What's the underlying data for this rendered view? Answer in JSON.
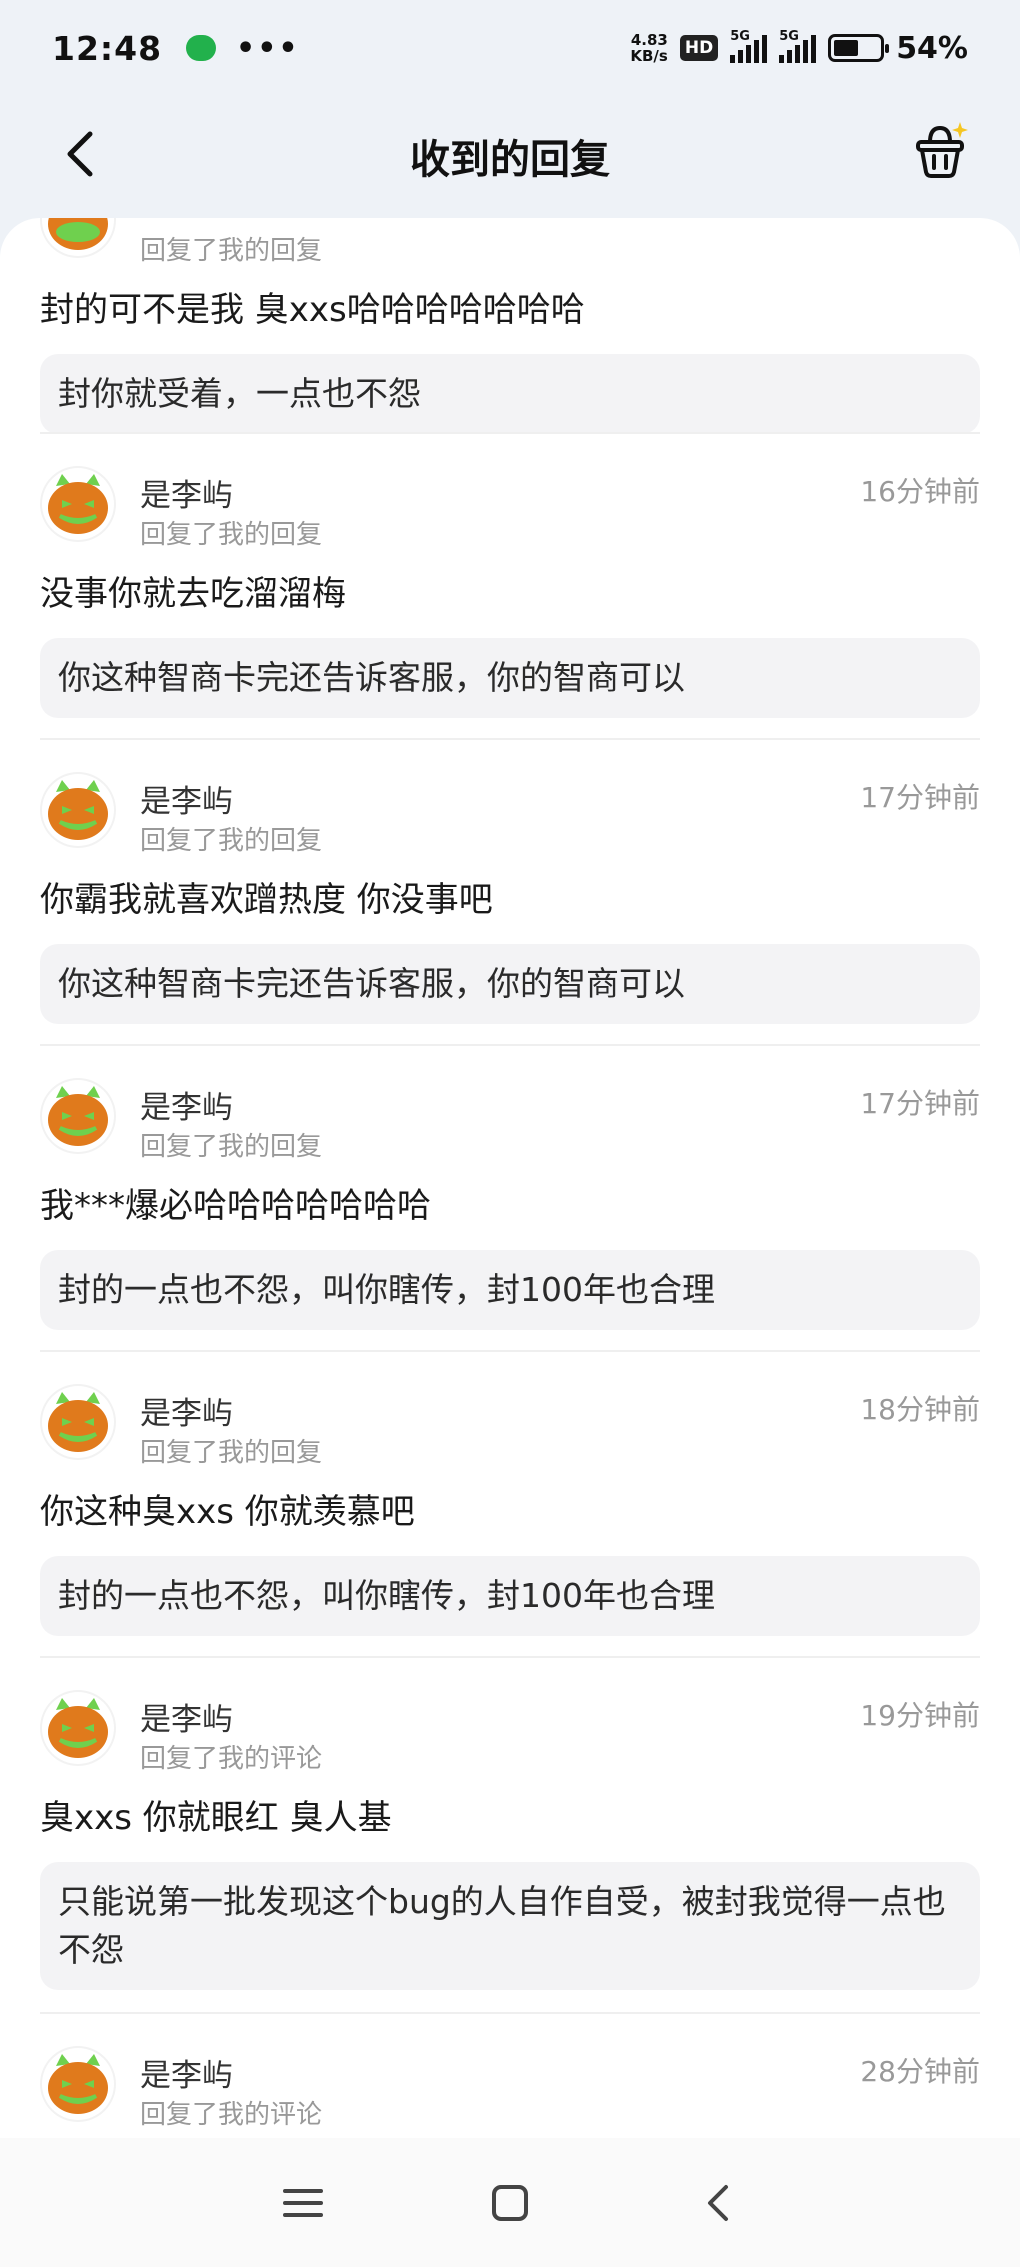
{
  "status_bar": {
    "time": "12:48",
    "dots": "•••",
    "net_speed_value": "4.83",
    "net_speed_unit": "KB/s",
    "hd_badge": "HD",
    "sim1": "5G",
    "sim2": "5G",
    "battery_percent": "54%",
    "battery_level": 0.54
  },
  "header": {
    "title": "收到的回复"
  },
  "partial_top": {
    "sub_label": "回复了我的回复",
    "reply_text": "封的可不是我 臭xxs哈哈哈哈哈哈哈",
    "quote": "封你就受着，一点也不怨"
  },
  "replies": [
    {
      "user": "是李屿",
      "sub_label": "回复了我的回复",
      "time": "16分钟前",
      "reply_text": "没事你就去吃溜溜梅",
      "quote": "你这种智商卡完还告诉客服，你的智商可以"
    },
    {
      "user": "是李屿",
      "sub_label": "回复了我的回复",
      "time": "17分钟前",
      "reply_text": "你霸我就喜欢蹭热度 你没事吧",
      "quote": "你这种智商卡完还告诉客服，你的智商可以"
    },
    {
      "user": "是李屿",
      "sub_label": "回复了我的回复",
      "time": "17分钟前",
      "reply_text": "我***爆必哈哈哈哈哈哈哈",
      "quote": "封的一点也不怨，叫你瞎传，封100年也合理"
    },
    {
      "user": "是李屿",
      "sub_label": "回复了我的回复",
      "time": "18分钟前",
      "reply_text": "你这种臭xxs 你就羡慕吧",
      "quote": "封的一点也不怨，叫你瞎传，封100年也合理"
    },
    {
      "user": "是李屿",
      "sub_label": "回复了我的评论",
      "time": "19分钟前",
      "reply_text": "臭xxs 你就眼红 臭人基",
      "quote": "只能说第一批发现这个bug的人自作自受，被封我觉得一点也不怨"
    },
    {
      "user": "是李屿",
      "sub_label": "回复了我的评论",
      "time": "28分钟前"
    }
  ],
  "colors": {
    "header_bg": "#eef2f7",
    "quote_bg": "#f3f3f5",
    "muted_text": "#999999",
    "avatar_orange": "#e07a1c",
    "avatar_green": "#6fd04e"
  },
  "icons": {
    "back": "chevron-left-icon",
    "basket": "shopping-basket-icon",
    "menu_key": "menu-icon",
    "home_key": "home-square-icon",
    "back_key": "back-triangle-icon"
  }
}
